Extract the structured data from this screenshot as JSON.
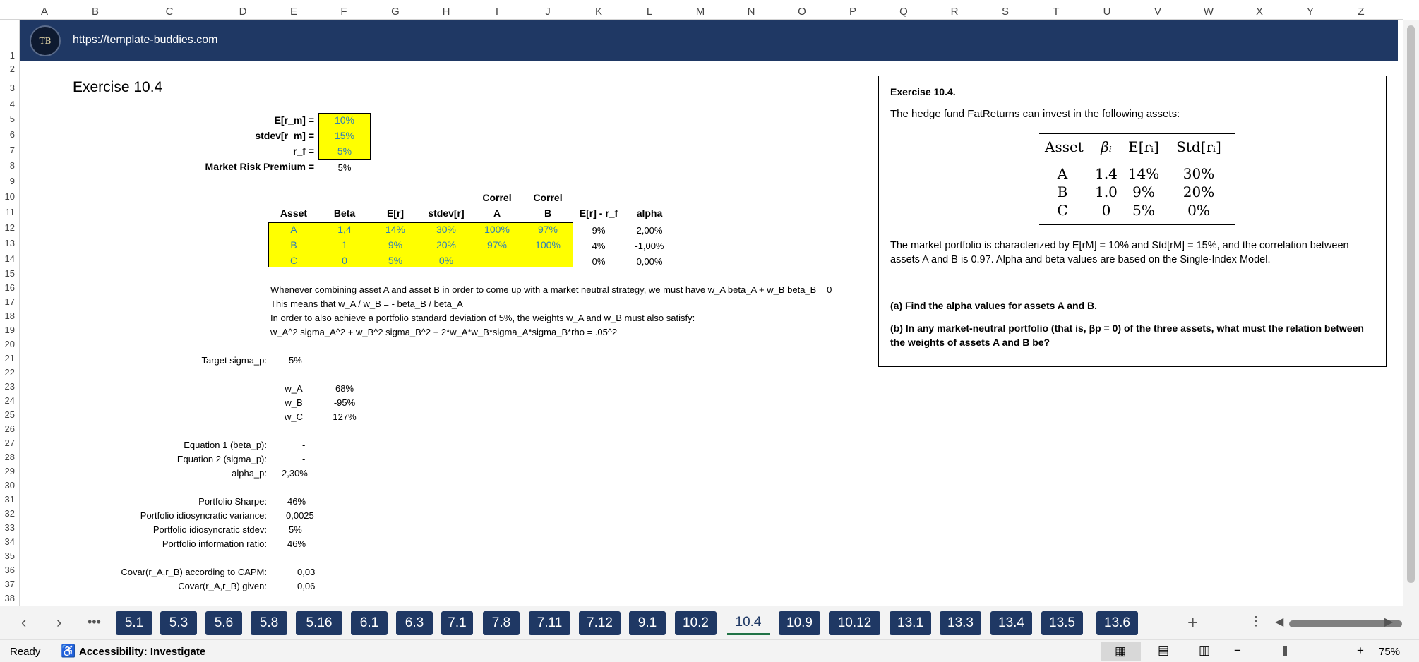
{
  "columns": [
    "A",
    "B",
    "C",
    "D",
    "E",
    "F",
    "G",
    "H",
    "I",
    "J",
    "K",
    "L",
    "M",
    "N",
    "O",
    "P",
    "Q",
    "R",
    "S",
    "T",
    "U",
    "V",
    "W",
    "X",
    "Y",
    "Z"
  ],
  "rows": [
    "1",
    "2",
    "3",
    "4",
    "5",
    "6",
    "7",
    "8",
    "9",
    "10",
    "11",
    "12",
    "13",
    "14",
    "15",
    "16",
    "17",
    "18",
    "19",
    "20",
    "21",
    "22",
    "23",
    "24",
    "25",
    "26",
    "27",
    "28",
    "29",
    "30",
    "31",
    "32",
    "33",
    "34",
    "35",
    "36",
    "37",
    "38"
  ],
  "banner": {
    "url": "https://template-buddies.com",
    "logo_text": "TB"
  },
  "title": "Exercise 10.4",
  "inputs": [
    {
      "label": "E[r_m] =",
      "value": "10%"
    },
    {
      "label": "stdev[r_m] =",
      "value": "15%"
    },
    {
      "label": "r_f =",
      "value": "5%"
    }
  ],
  "mrp": {
    "label": "Market Risk Premium =",
    "value": "5%"
  },
  "asset_table": {
    "header_top": [
      "",
      "",
      "",
      "",
      "Correl",
      "Correl",
      "",
      ""
    ],
    "headers": [
      "Asset",
      "Beta",
      "E[r]",
      "stdev[r]",
      "A",
      "B",
      "E[r] - r_f",
      "alpha"
    ],
    "rows": [
      [
        "A",
        "1,4",
        "14%",
        "30%",
        "100%",
        "97%",
        "9%",
        "2,00%"
      ],
      [
        "B",
        "1",
        "9%",
        "20%",
        "97%",
        "100%",
        "4%",
        "-1,00%"
      ],
      [
        "C",
        "0",
        "5%",
        "0%",
        "",
        "",
        "0%",
        "0,00%"
      ]
    ]
  },
  "notes": [
    "Whenever combining asset A and asset B in order to come up with a market neutral strategy, we must have w_A beta_A + w_B beta_B = 0",
    "This means that w_A / w_B = - beta_B / beta_A",
    "In order to also achieve a portfolio standard deviation of 5%, the weights w_A and w_B must also satisfy:",
    "w_A^2 sigma_A^2 + w_B^2 sigma_B^2 + 2*w_A*w_B*sigma_A*sigma_B*rho = .05^2"
  ],
  "target": {
    "label": "Target sigma_p:",
    "value": "5%"
  },
  "weights": [
    {
      "label": "w_A",
      "value": "68%"
    },
    {
      "label": "w_B",
      "value": "-95%"
    },
    {
      "label": "w_C",
      "value": "127%"
    }
  ],
  "equations": [
    {
      "label": "Equation 1 (beta_p):",
      "value": "-"
    },
    {
      "label": "Equation 2 (sigma_p):",
      "value": "-"
    },
    {
      "label": "alpha_p:",
      "value": "2,30%"
    }
  ],
  "portfolio": [
    {
      "label": "Portfolio Sharpe:",
      "value": "46%"
    },
    {
      "label": "Portfolio idiosyncratic variance:",
      "value": "0,0025"
    },
    {
      "label": "Portfolio idiosyncratic stdev:",
      "value": "5%"
    },
    {
      "label": "Portfolio information ratio:",
      "value": "46%"
    }
  ],
  "covar": [
    {
      "label": "Covar(r_A,r_B) according to CAPM:",
      "value": "0,03"
    },
    {
      "label": "Covar(r_A,r_B) given:",
      "value": "0,06"
    }
  ],
  "exercise_box": {
    "heading": "Exercise 10.4.",
    "intro": "The hedge fund FatReturns can invest in the following assets:",
    "table_headers": [
      "Asset",
      "βᵢ",
      "E[rᵢ]",
      "Std[rᵢ]"
    ],
    "table_rows": [
      [
        "A",
        "1.4",
        "14%",
        "30%"
      ],
      [
        "B",
        "1.0",
        "9%",
        "20%"
      ],
      [
        "C",
        "0",
        "5%",
        "0%"
      ]
    ],
    "para1": "The market portfolio is characterized by E[rM] = 10% and Std[rM] = 15%, and the correlation between",
    "para2": "assets A and B is 0.97. Alpha and beta values are based on the Single-Index Model.",
    "qa": "(a) Find the alpha values for assets A and B.",
    "qb1": "(b) In any market-neutral portfolio (that is, βp = 0) of the three assets, what must the relation between",
    "qb2": "the weights of assets A and B be?"
  },
  "tabs": [
    "5.1",
    "5.3",
    "5.6",
    "5.8",
    "5.16",
    "6.1",
    "6.3",
    "7.1",
    "7.8",
    "7.11",
    "7.12",
    "9.1",
    "10.2",
    "10.4",
    "10.9",
    "10.12",
    "13.1",
    "13.3",
    "13.4",
    "13.5",
    "13.6"
  ],
  "active_tab": "10.4",
  "status": {
    "ready": "Ready",
    "accessibility": "Accessibility: Investigate",
    "zoom": "75%"
  }
}
